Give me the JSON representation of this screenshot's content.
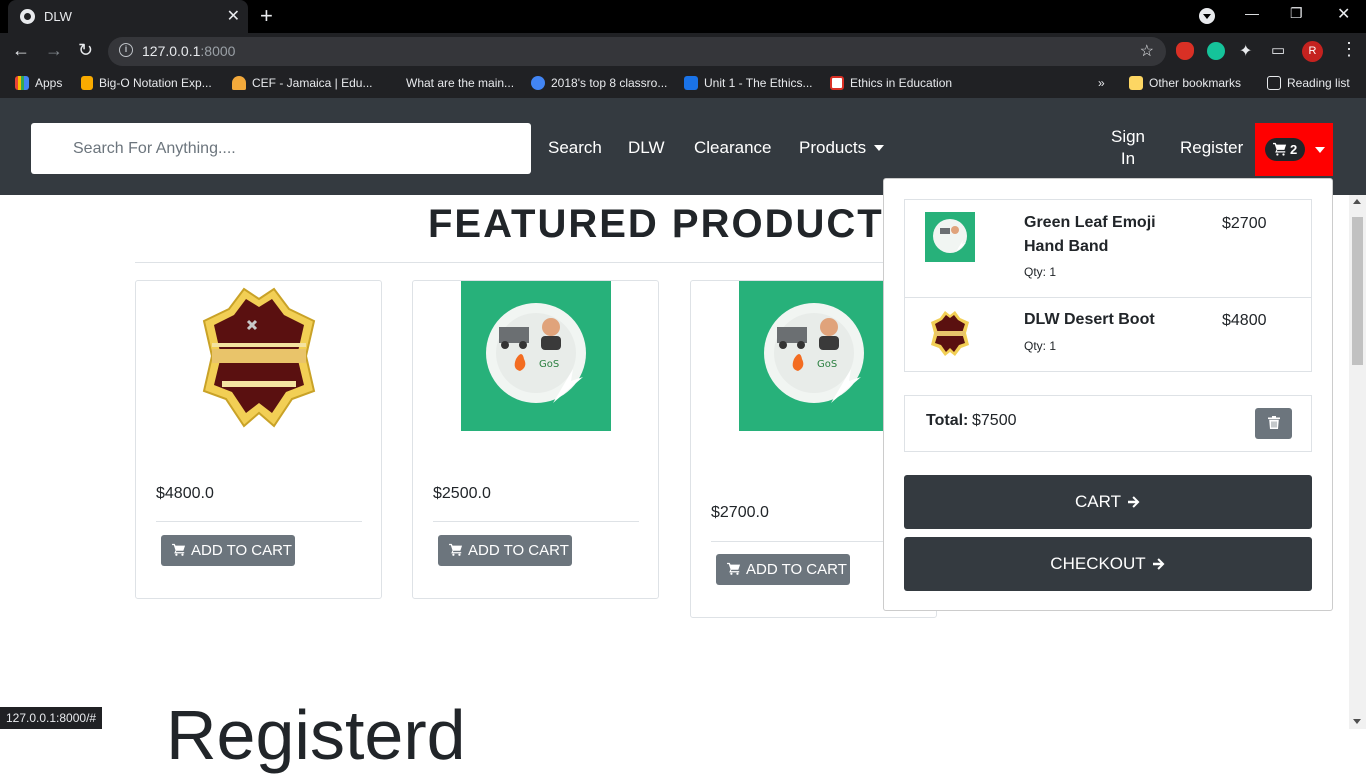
{
  "browser": {
    "tab_title": "DLW",
    "url_host": "127.0.0.1",
    "url_port": ":8000",
    "profile_initial": "R",
    "status_url": "127.0.0.1:8000/#",
    "bookmarks": [
      {
        "label": "Apps"
      },
      {
        "label": "Big-O Notation Exp..."
      },
      {
        "label": "CEF - Jamaica | Edu..."
      },
      {
        "label": "What are the main..."
      },
      {
        "label": "2018's top 8 classro..."
      },
      {
        "label": "Unit 1 - The Ethics..."
      },
      {
        "label": "Ethics in Education"
      }
    ],
    "bookmarks_overflow": "»",
    "other_bookmarks": "Other bookmarks",
    "reading_list": "Reading list"
  },
  "navbar": {
    "search_placeholder": "Search For Anything....",
    "search_label": "Search",
    "links": [
      {
        "label": "DLW"
      },
      {
        "label": "Clearance"
      },
      {
        "label": "Products"
      }
    ],
    "signin_line1": "Sign",
    "signin_line2": "In",
    "register_label": "Register",
    "cart_count": "2",
    "cart_color": "#ff0000"
  },
  "main": {
    "featured_title": "FEATURED PRODUCT",
    "partial_heading": "Registerd",
    "products": [
      {
        "price": "$4800.0",
        "button": "ADD TO CART",
        "image": "leather-works-logo"
      },
      {
        "price": "$2500.0",
        "button": "ADD TO CART",
        "image": "gos-time-logo"
      },
      {
        "price": "$2700.0",
        "button": "ADD TO CART",
        "image": "gos-time-logo"
      }
    ]
  },
  "cart_dropdown": {
    "items": [
      {
        "name_line1": "Green Leaf Emoji",
        "name_line2": "Hand Band",
        "qty": "Qty: 1",
        "price": "$2700"
      },
      {
        "name_line1": "DLW Desert Boot",
        "name_line2": "",
        "qty": "Qty: 1",
        "price": "$4800"
      }
    ],
    "total_label": "Total:",
    "total_value": "$7500",
    "cart_button": "CART",
    "checkout_button": "CHECKOUT"
  }
}
